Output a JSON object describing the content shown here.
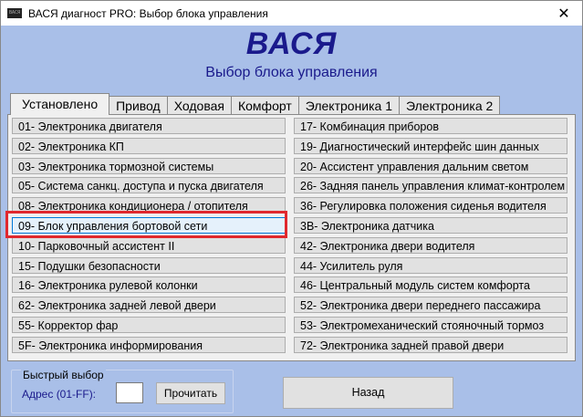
{
  "window": {
    "title": "ВАСЯ диагност PRO:  Выбор блока управления",
    "icon_text": "ВАСЯ",
    "close_glyph": "✕"
  },
  "header": {
    "logo": "ВАСЯ",
    "subtitle": "Выбор блока управления"
  },
  "tabs": [
    {
      "label": "Установлено",
      "active": true
    },
    {
      "label": "Привод"
    },
    {
      "label": "Ходовая"
    },
    {
      "label": "Комфорт"
    },
    {
      "label": "Электроника 1"
    },
    {
      "label": "Электроника 2"
    }
  ],
  "left_items": [
    "01- Электроника двигателя",
    "02- Электроника КП",
    "03- Электроника тормозной системы",
    "05- Система санкц. доступа и пуска двигателя",
    "08- Электроника кондиционера / отопителя",
    "09- Блок управления бортовой сети",
    "10- Парковочный ассистент II",
    "15- Подушки безопасности",
    "16- Электроника рулевой колонки",
    "62- Электроника задней левой двери",
    "55- Корректор фар",
    "5F- Электроника информирования"
  ],
  "right_items": [
    "17- Комбинация приборов",
    "19- Диагностический интерфейс шин данных",
    "20- Ассистент управления дальним светом",
    "26- Задняя панель управления климат-контролем",
    "36- Регулировка положения сиденья водителя",
    "3B- Электроника датчика",
    "42- Электроника двери водителя",
    "44- Усилитель руля",
    "46- Центральный модуль систем комфорта",
    "52- Электроника двери переднего пассажира",
    "53- Электромеханический стояночный тормоз",
    "72- Электроника задней правой двери"
  ],
  "selected_left_index": 5,
  "highlight_color": "#e0282e",
  "quick_select": {
    "group_label": "Быстрый выбор",
    "address_label": "Адрес (01-FF):",
    "address_value": "",
    "read_button": "Прочитать"
  },
  "back_button": "Назад"
}
